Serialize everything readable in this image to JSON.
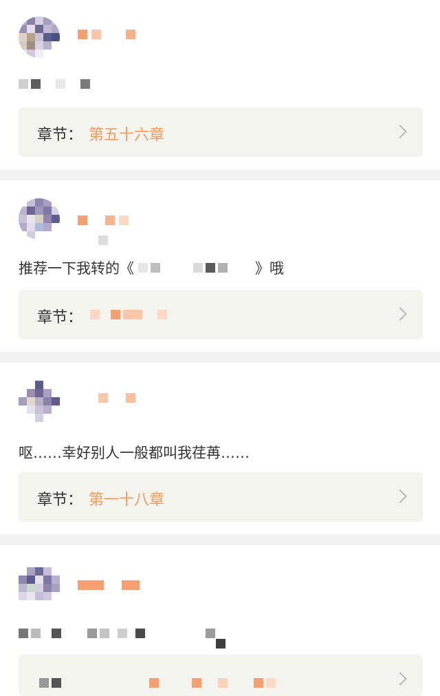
{
  "comments": [
    {
      "text": "",
      "chapter_label": "章节：",
      "chapter_value": "第五十六章"
    },
    {
      "text": "推荐一下我转的《",
      "text_suffix": "》哦",
      "chapter_label": "章节：",
      "chapter_value": ""
    },
    {
      "text": "呕……幸好别人一般都叫我荏苒……",
      "chapter_label": "章节：",
      "chapter_value": "第一十八章"
    },
    {
      "text": "",
      "chapter_label": "",
      "chapter_value": ""
    }
  ],
  "icons": {
    "chevron": "chevron-right-icon"
  },
  "colors": {
    "accent": "#f39a5c",
    "chapter_bg": "#f4f4ef",
    "separator": "#f2f2f2",
    "tab": "#e85a9a"
  }
}
